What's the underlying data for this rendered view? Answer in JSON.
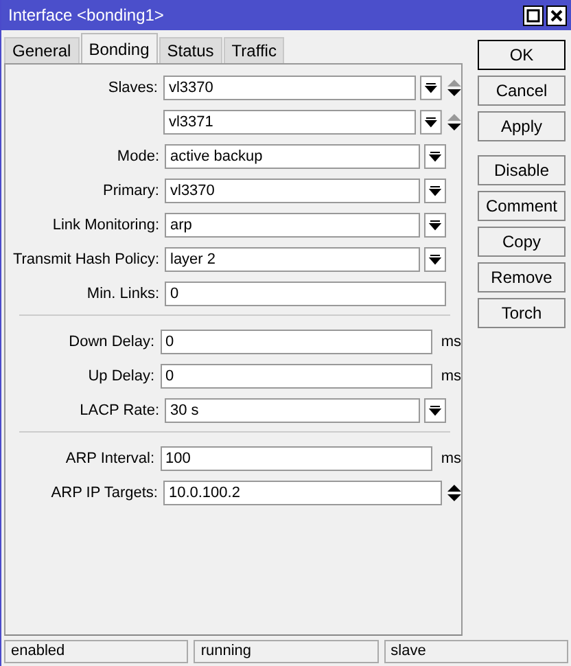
{
  "window": {
    "title": "Interface <bonding1>"
  },
  "tabs": [
    {
      "label": "General",
      "selected": false
    },
    {
      "label": "Bonding",
      "selected": true
    },
    {
      "label": "Status",
      "selected": false
    },
    {
      "label": "Traffic",
      "selected": false
    }
  ],
  "groups": [
    [
      {
        "label": "Slaves:",
        "value": "vl3370",
        "kind": "select",
        "updown": true,
        "up_enabled": false
      },
      {
        "value": "vl3371",
        "kind": "select",
        "updown": true,
        "up_enabled": false
      },
      {
        "label": "Mode:",
        "value": "active backup",
        "kind": "select"
      },
      {
        "label": "Primary:",
        "value": "vl3370",
        "kind": "select"
      },
      {
        "label": "Link Monitoring:",
        "value": "arp",
        "kind": "select"
      },
      {
        "label": "Transmit Hash Policy:",
        "value": "layer 2",
        "kind": "select"
      },
      {
        "label": "Min. Links:",
        "value": "0",
        "kind": "text"
      }
    ],
    [
      {
        "label": "Down Delay:",
        "value": "0",
        "kind": "text",
        "unit": "ms"
      },
      {
        "label": "Up Delay:",
        "value": "0",
        "kind": "text",
        "unit": "ms"
      },
      {
        "label": "LACP Rate:",
        "value": "30 s",
        "kind": "select"
      }
    ],
    [
      {
        "label": "ARP Interval:",
        "value": "100",
        "kind": "text",
        "unit": "ms"
      },
      {
        "label": "ARP IP Targets:",
        "value": "10.0.100.2",
        "kind": "text",
        "updown": true,
        "up_enabled": true
      }
    ]
  ],
  "buttons": [
    {
      "label": "OK",
      "kind": "default"
    },
    {
      "label": "Cancel",
      "kind": "normal"
    },
    {
      "label": "Apply",
      "kind": "normal"
    },
    {
      "label": "Disable",
      "kind": "gap"
    },
    {
      "label": "Comment",
      "kind": "normal"
    },
    {
      "label": "Copy",
      "kind": "normal"
    },
    {
      "label": "Remove",
      "kind": "normal"
    },
    {
      "label": "Torch",
      "kind": "normal"
    }
  ],
  "status_bar": [
    "enabled",
    "running",
    "slave"
  ]
}
